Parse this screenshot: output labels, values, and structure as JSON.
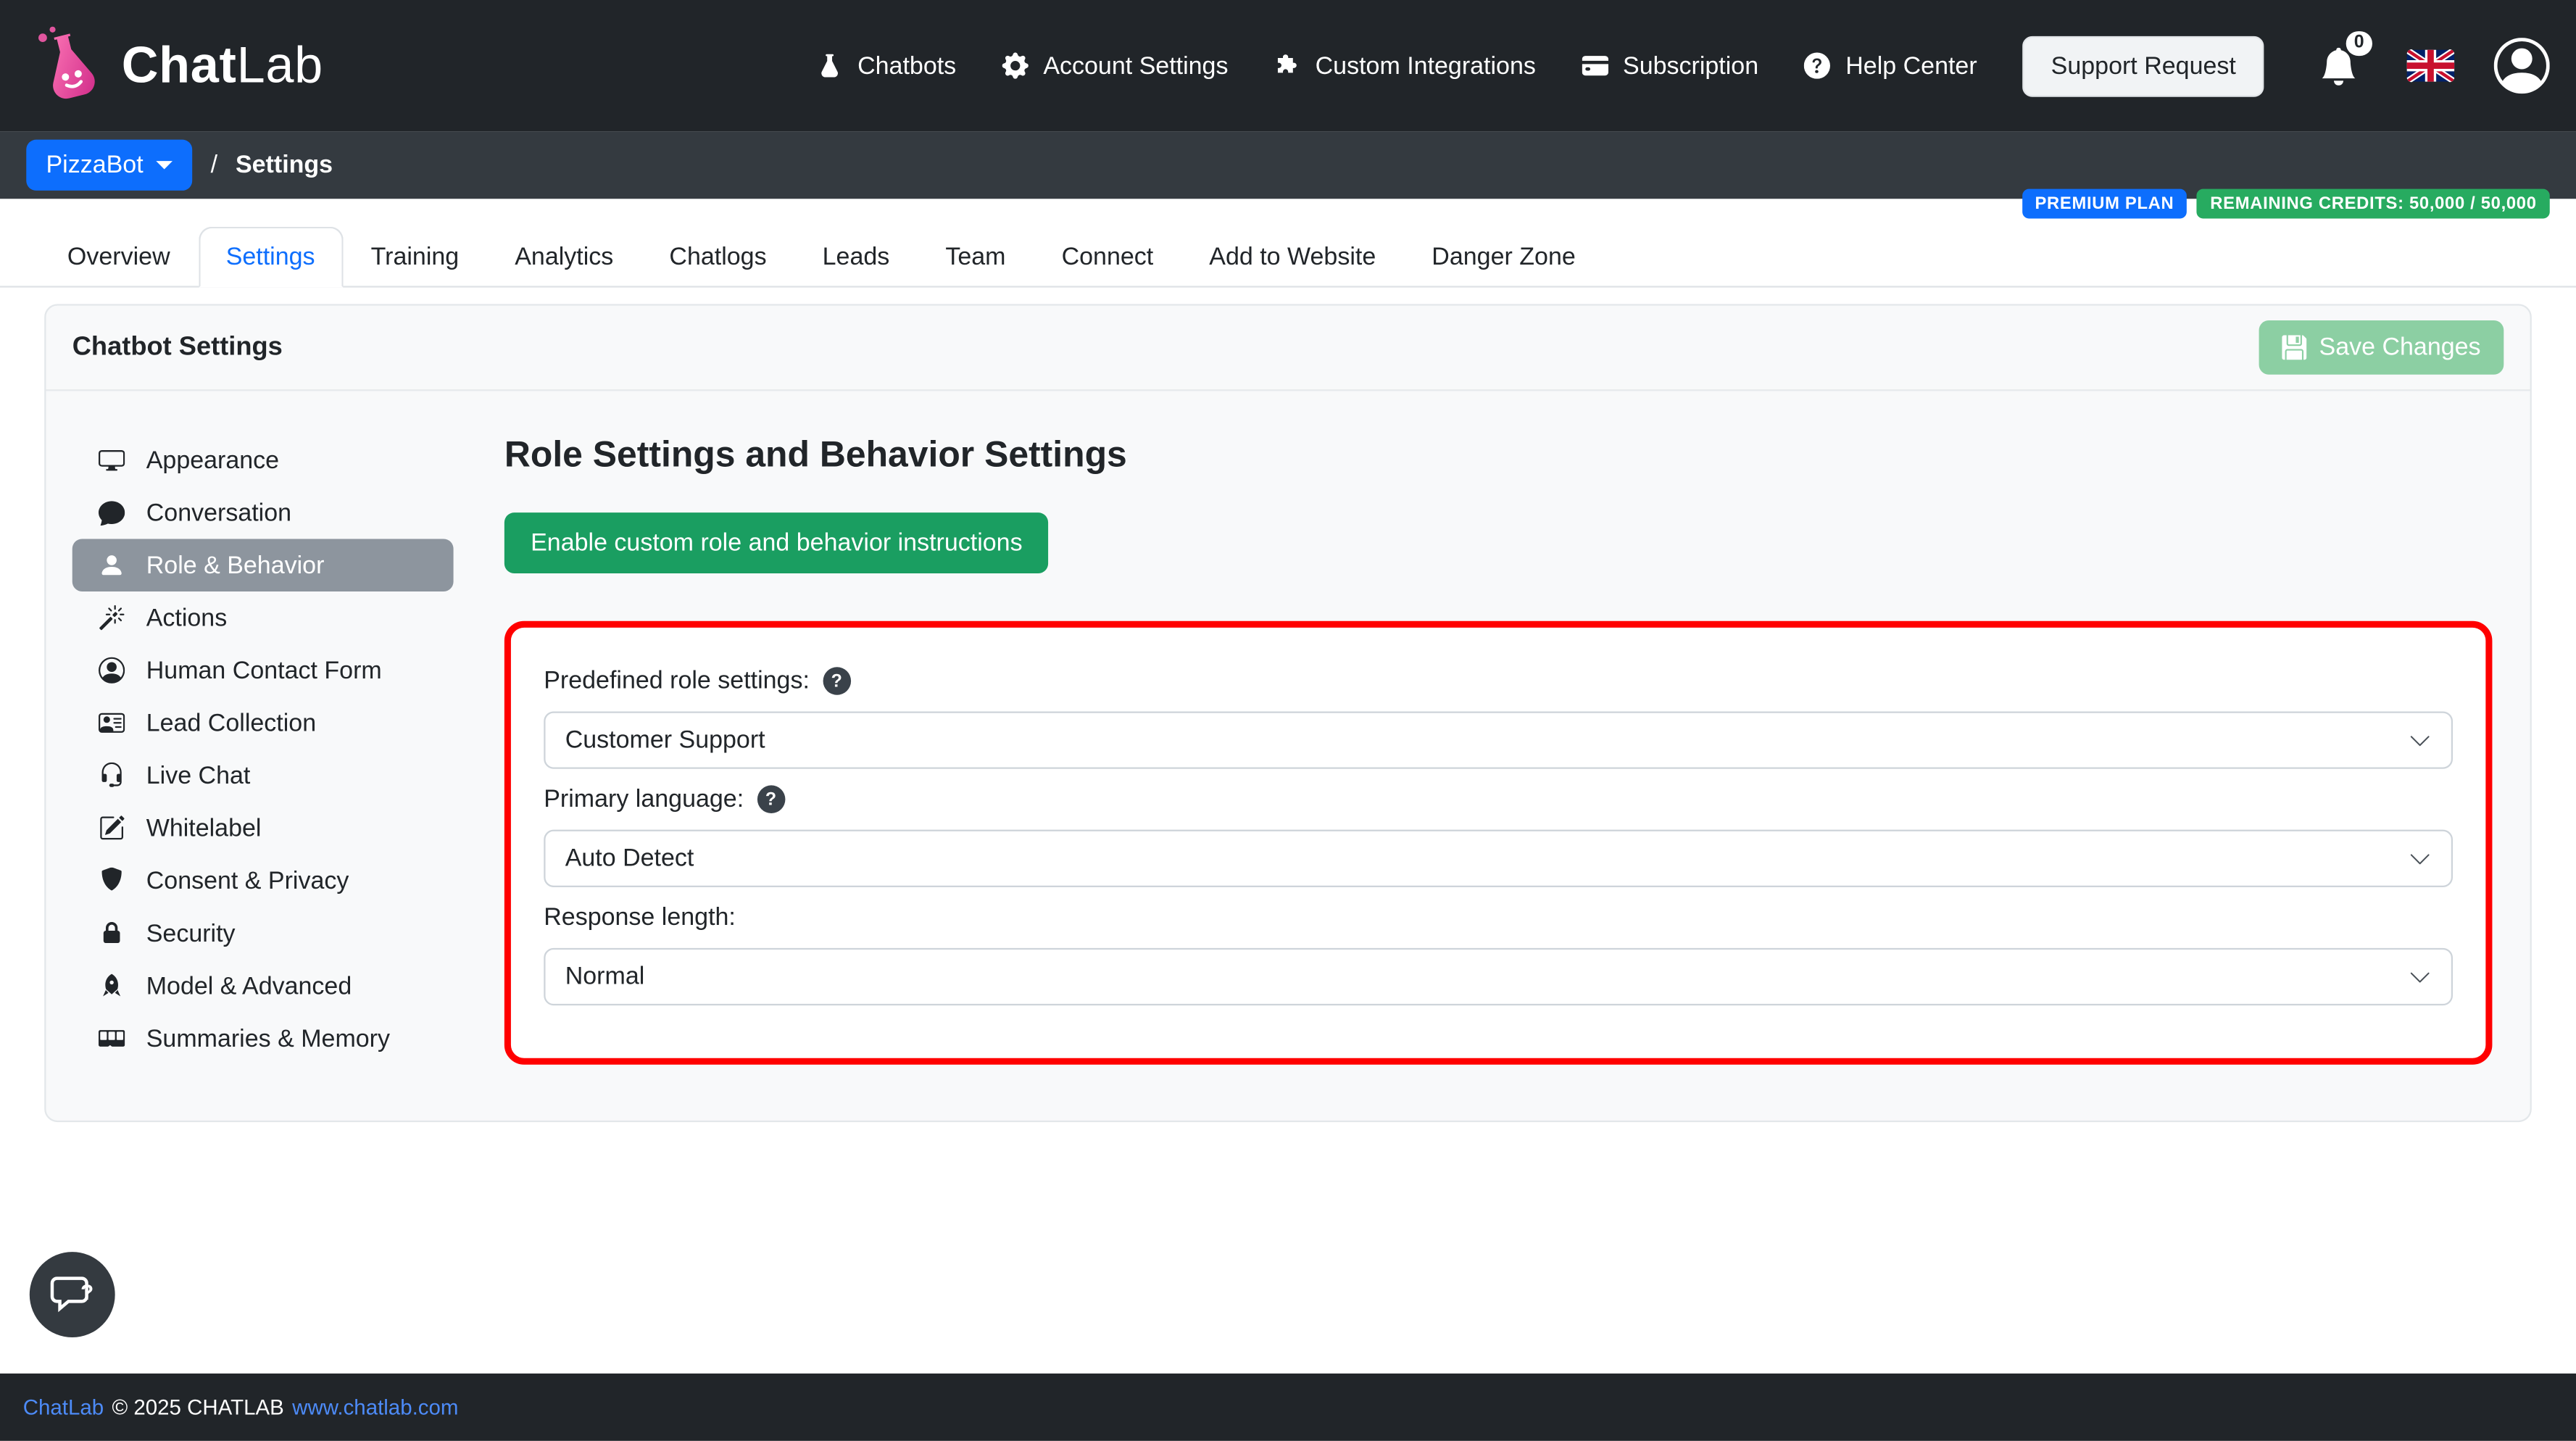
{
  "brand": {
    "name_part1": "Chat",
    "name_part2": "Lab"
  },
  "navbar": {
    "items": [
      {
        "label": "Chatbots",
        "icon": "flask-icon"
      },
      {
        "label": "Account Settings",
        "icon": "gear-icon"
      },
      {
        "label": "Custom Integrations",
        "icon": "puzzle-icon"
      },
      {
        "label": "Subscription",
        "icon": "credit-card-icon"
      },
      {
        "label": "Help Center",
        "icon": "question-circle-icon"
      }
    ],
    "support_button_label": "Support Request",
    "notification_count": "0"
  },
  "breadcrumb": {
    "bot_name": "PizzaBot",
    "separator": "/",
    "current_page": "Settings"
  },
  "badges": {
    "plan": "PREMIUM PLAN",
    "credits": "REMAINING CREDITS: 50,000 / 50,000"
  },
  "tabs": {
    "items": [
      "Overview",
      "Settings",
      "Training",
      "Analytics",
      "Chatlogs",
      "Leads",
      "Team",
      "Connect",
      "Add to Website",
      "Danger Zone"
    ],
    "active": "Settings"
  },
  "card": {
    "title": "Chatbot Settings",
    "save_button_label": "Save Changes"
  },
  "sidebar": {
    "items": [
      {
        "label": "Appearance",
        "icon": "display-icon"
      },
      {
        "label": "Conversation",
        "icon": "chat-bubble-icon"
      },
      {
        "label": "Role & Behavior",
        "icon": "person-icon",
        "active": true
      },
      {
        "label": "Actions",
        "icon": "magic-wand-icon"
      },
      {
        "label": "Human Contact Form",
        "icon": "person-circle-icon"
      },
      {
        "label": "Lead Collection",
        "icon": "contact-card-icon"
      },
      {
        "label": "Live Chat",
        "icon": "headset-icon"
      },
      {
        "label": "Whitelabel",
        "icon": "pencil-square-icon"
      },
      {
        "label": "Consent & Privacy",
        "icon": "shield-icon"
      },
      {
        "label": "Security",
        "icon": "lock-icon"
      },
      {
        "label": "Model & Advanced",
        "icon": "rocket-icon"
      },
      {
        "label": "Summaries & Memory",
        "icon": "memory-icon"
      }
    ]
  },
  "content": {
    "title": "Role Settings and Behavior Settings",
    "enable_button_label": "Enable custom role and behavior instructions",
    "fields": [
      {
        "label": "Predefined role settings:",
        "value": "Customer Support",
        "has_help": true
      },
      {
        "label": "Primary language:",
        "value": "Auto Detect",
        "has_help": true
      },
      {
        "label": "Response length:",
        "value": "Normal",
        "has_help": false
      }
    ]
  },
  "footer": {
    "brand_link": "ChatLab",
    "copyright": "© 2025 CHATLAB",
    "website_link": "www.chatlab.com"
  },
  "colors": {
    "accent_blue": "#0d6efd",
    "success_green": "#1a9e61",
    "badge_green": "#27ab60",
    "highlight_red": "#ff0000",
    "navbar_dark": "#212529",
    "subnav_dark": "#343a40",
    "active_item_gray": "#8d959e",
    "brand_pink": "#d5308f"
  }
}
